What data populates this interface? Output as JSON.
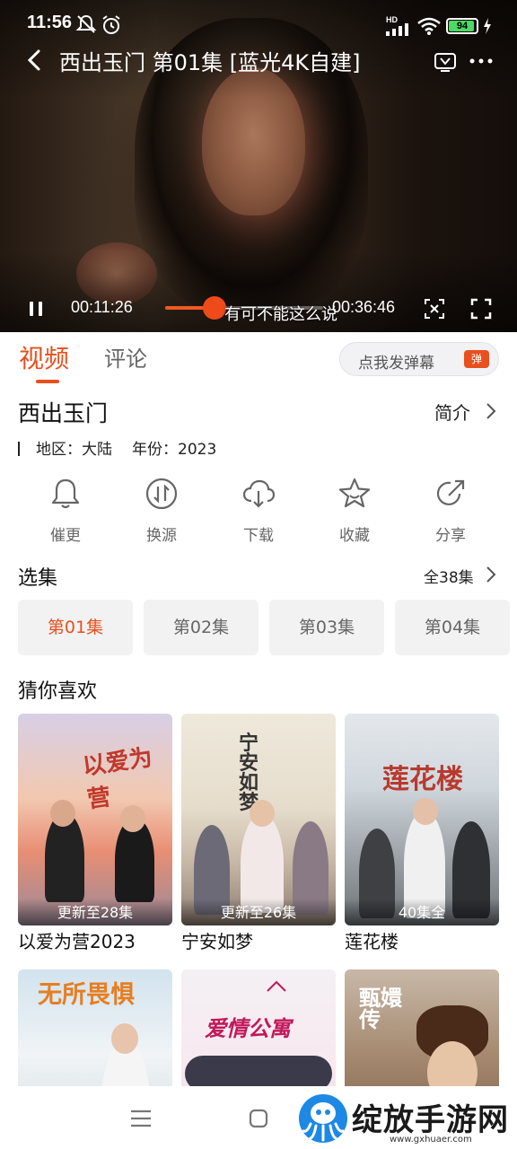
{
  "status_bar": {
    "time": "11:56",
    "network": "HD",
    "battery_level": "94",
    "battery_fraction": 0.94
  },
  "player": {
    "title": "西出玉门  第01集  [蓝光4K自建]",
    "current_time": "00:11:26",
    "total_time": "00:36:46",
    "progress_fraction": 0.31,
    "subtitle": "有可不能这么说"
  },
  "tabs": [
    {
      "label": "视频",
      "active": true
    },
    {
      "label": "评论",
      "active": false
    }
  ],
  "danmaku": {
    "label": "点我发弹幕",
    "badge": "弹"
  },
  "info": {
    "title": "西出玉门",
    "intro_label": "简介",
    "region_label": "地区：",
    "region": "大陆",
    "year_label": "年份：",
    "year": "2023"
  },
  "actions": [
    {
      "label": "催更",
      "icon": "bell-icon"
    },
    {
      "label": "换源",
      "icon": "switch-source-icon"
    },
    {
      "label": "下载",
      "icon": "cloud-download-icon"
    },
    {
      "label": "收藏",
      "icon": "star-icon"
    },
    {
      "label": "分享",
      "icon": "share-icon"
    }
  ],
  "episodes": {
    "section_title": "选集",
    "all_label": "全38集",
    "items": [
      "第01集",
      "第02集",
      "第03集",
      "第04集"
    ],
    "selected_index": 0
  },
  "recommend": {
    "section_title": "猜你喜欢",
    "items": [
      {
        "name": "以爱为营2023",
        "badge": "更新至28集",
        "poster_text": "以爱为营"
      },
      {
        "name": "宁安如梦",
        "badge": "更新至26集",
        "poster_text": "宁安如梦"
      },
      {
        "name": "莲花楼",
        "badge": "40集全",
        "poster_text": "莲花楼"
      },
      {
        "name": "",
        "badge": "",
        "poster_text": "无所畏惧"
      },
      {
        "name": "",
        "badge": "",
        "poster_text": "爱情公寓"
      },
      {
        "name": "",
        "badge": "",
        "poster_text": "甄嬛传"
      }
    ]
  },
  "watermark": {
    "text": "绽放手游网",
    "url": "www.gxhuaer.com"
  },
  "colors": {
    "accent": "#e8501e",
    "progress_played": "#ee5a24",
    "battery": "#4cd964"
  }
}
